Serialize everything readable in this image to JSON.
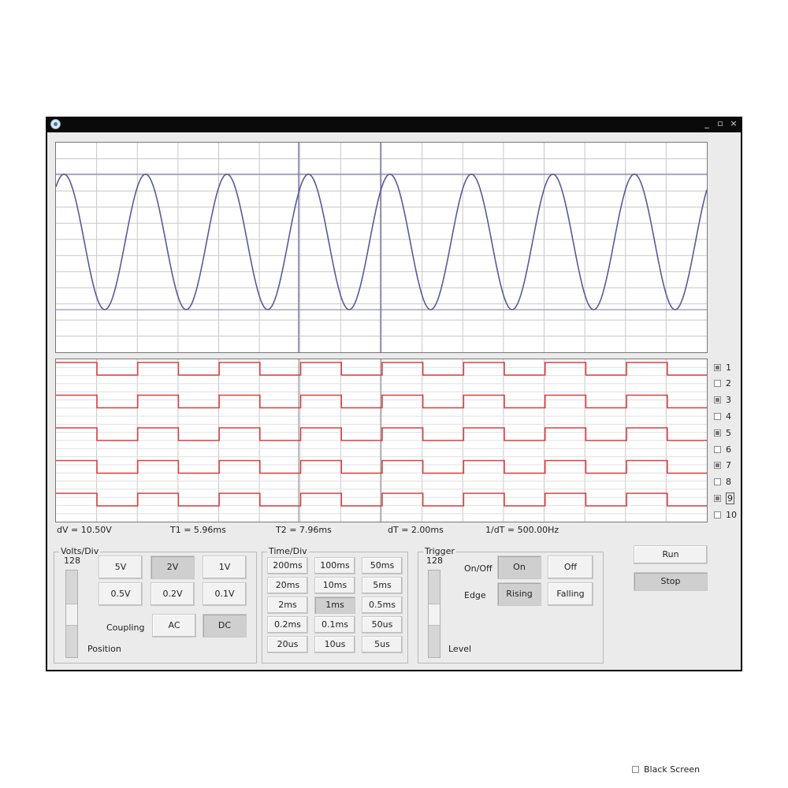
{
  "window": {
    "min": "_",
    "max": "▫",
    "close": "×"
  },
  "channels": [
    {
      "label": "1",
      "checked": true
    },
    {
      "label": "2",
      "checked": false
    },
    {
      "label": "3",
      "checked": true
    },
    {
      "label": "4",
      "checked": false
    },
    {
      "label": "5",
      "checked": true
    },
    {
      "label": "6",
      "checked": false
    },
    {
      "label": "7",
      "checked": true
    },
    {
      "label": "8",
      "checked": false
    },
    {
      "label": "9",
      "checked": true
    },
    {
      "label": "10",
      "checked": false
    }
  ],
  "readouts": {
    "dv": "dV = 10.50V",
    "t1": "T1 = 5.96ms",
    "t2": "T2 = 7.96ms",
    "dt": "dT = 2.00ms",
    "freq": "1/dT = 500.00Hz"
  },
  "volts": {
    "title": "Volts/Div",
    "slider_value": "128",
    "buttons": [
      "5V",
      "2V",
      "1V",
      "0.5V",
      "0.2V",
      "0.1V"
    ],
    "selected": "2V",
    "coupling_label": "Coupling",
    "coupling_ac": "AC",
    "coupling_dc": "DC",
    "coupling_selected": "DC",
    "position_label": "Position"
  },
  "time": {
    "title": "Time/Div",
    "buttons": [
      "200ms",
      "100ms",
      "50ms",
      "20ms",
      "10ms",
      "5ms",
      "2ms",
      "1ms",
      "0.5ms",
      "0.2ms",
      "0.1ms",
      "50us",
      "20us",
      "10us",
      "5us"
    ],
    "selected": "1ms"
  },
  "trigger": {
    "title": "Trigger",
    "slider_value": "128",
    "onoff_label": "On/Off",
    "on": "On",
    "off": "Off",
    "edge_label": "Edge",
    "rising": "Rising",
    "falling": "Falling",
    "level_label": "Level",
    "onoff_selected": "On",
    "edge_selected": "Rising"
  },
  "controls": {
    "run": "Run",
    "stop": "Stop",
    "stop_selected": true,
    "black_screen": "Black Screen",
    "black_screen_checked": false
  },
  "colors": {
    "analog_trace": "#5a5a9a",
    "digital_trace": "#d84040",
    "grid": "#c8c8c8",
    "cursor": "#7a7aaa"
  },
  "icons": {
    "app": "scope-app-icon",
    "minimize": "minimize-icon",
    "maximize": "maximize-icon",
    "close": "close-icon"
  }
}
